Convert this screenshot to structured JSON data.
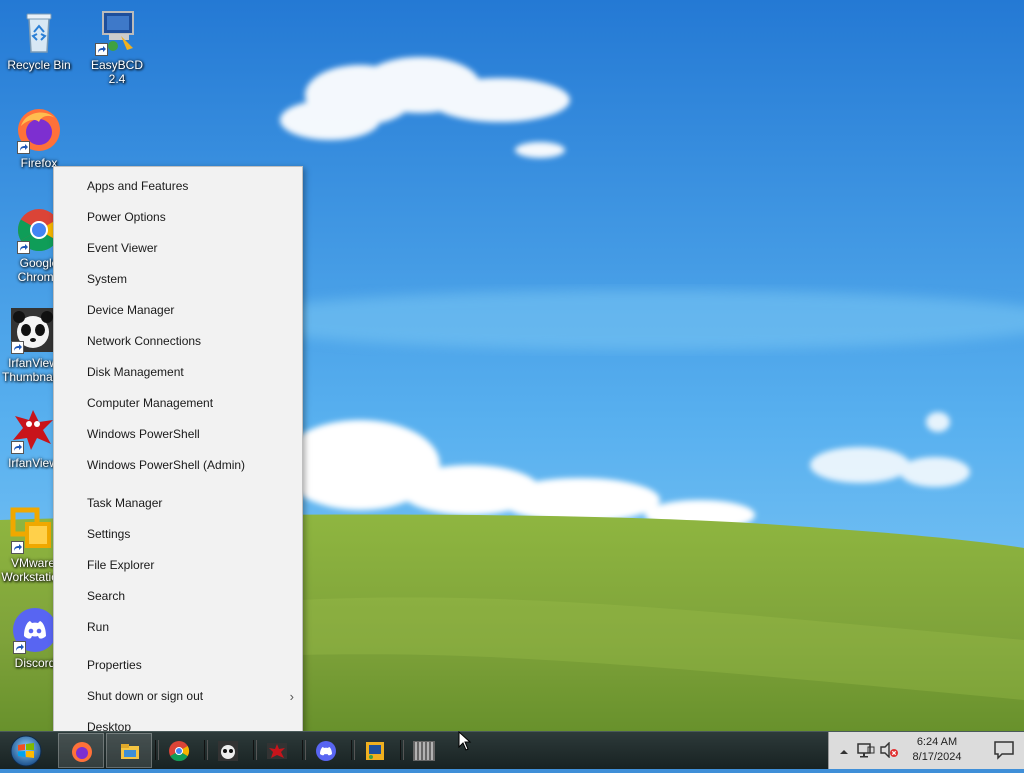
{
  "desktop": {
    "icons": [
      {
        "name": "recycle-bin",
        "label": "Recycle Bin"
      },
      {
        "name": "easybcd",
        "label": "EasyBCD 2.4"
      },
      {
        "name": "firefox",
        "label": "Firefox"
      },
      {
        "name": "google-chrome",
        "label": "Google\nChrome"
      },
      {
        "name": "irfanview-thumbnails",
        "label": "IrfanView\nThumbnails"
      },
      {
        "name": "irfanview",
        "label": "IrfanView"
      },
      {
        "name": "vmware-workstation",
        "label": "VMware\nWorkstation"
      },
      {
        "name": "discord",
        "label": "Discord"
      }
    ]
  },
  "context_menu": {
    "groups": [
      [
        "Apps and Features",
        "Power Options",
        "Event Viewer",
        "System",
        "Device Manager",
        "Network Connections",
        "Disk Management",
        "Computer Management",
        "Windows PowerShell",
        "Windows PowerShell (Admin)"
      ],
      [
        "Task Manager",
        "Settings",
        "File Explorer",
        "Search",
        "Run"
      ],
      [
        "Properties",
        "Shut down or sign out",
        "Desktop"
      ]
    ],
    "submenu_arrow": "›"
  },
  "taskbar": {
    "start_icon": "windows-logo-icon",
    "pinned": [
      "firefox-icon",
      "file-explorer-icon",
      "chrome-icon",
      "irfanview-thumbnails-icon",
      "irfanview-icon",
      "discord-icon",
      "easybcd-icon",
      "vmware-icon"
    ]
  },
  "tray": {
    "time": "6:24 AM",
    "date": "8/17/2024",
    "icons": [
      "chevron-up-icon",
      "network-icon",
      "volume-muted-icon",
      "action-center-icon"
    ]
  },
  "colors": {
    "sky_top": "#2a7fd6",
    "sky_bottom": "#6cc3f5",
    "grass": "#7ea43a",
    "menu_bg": "#f2f2f2",
    "taskbar_bg": "#1f2a2a"
  }
}
